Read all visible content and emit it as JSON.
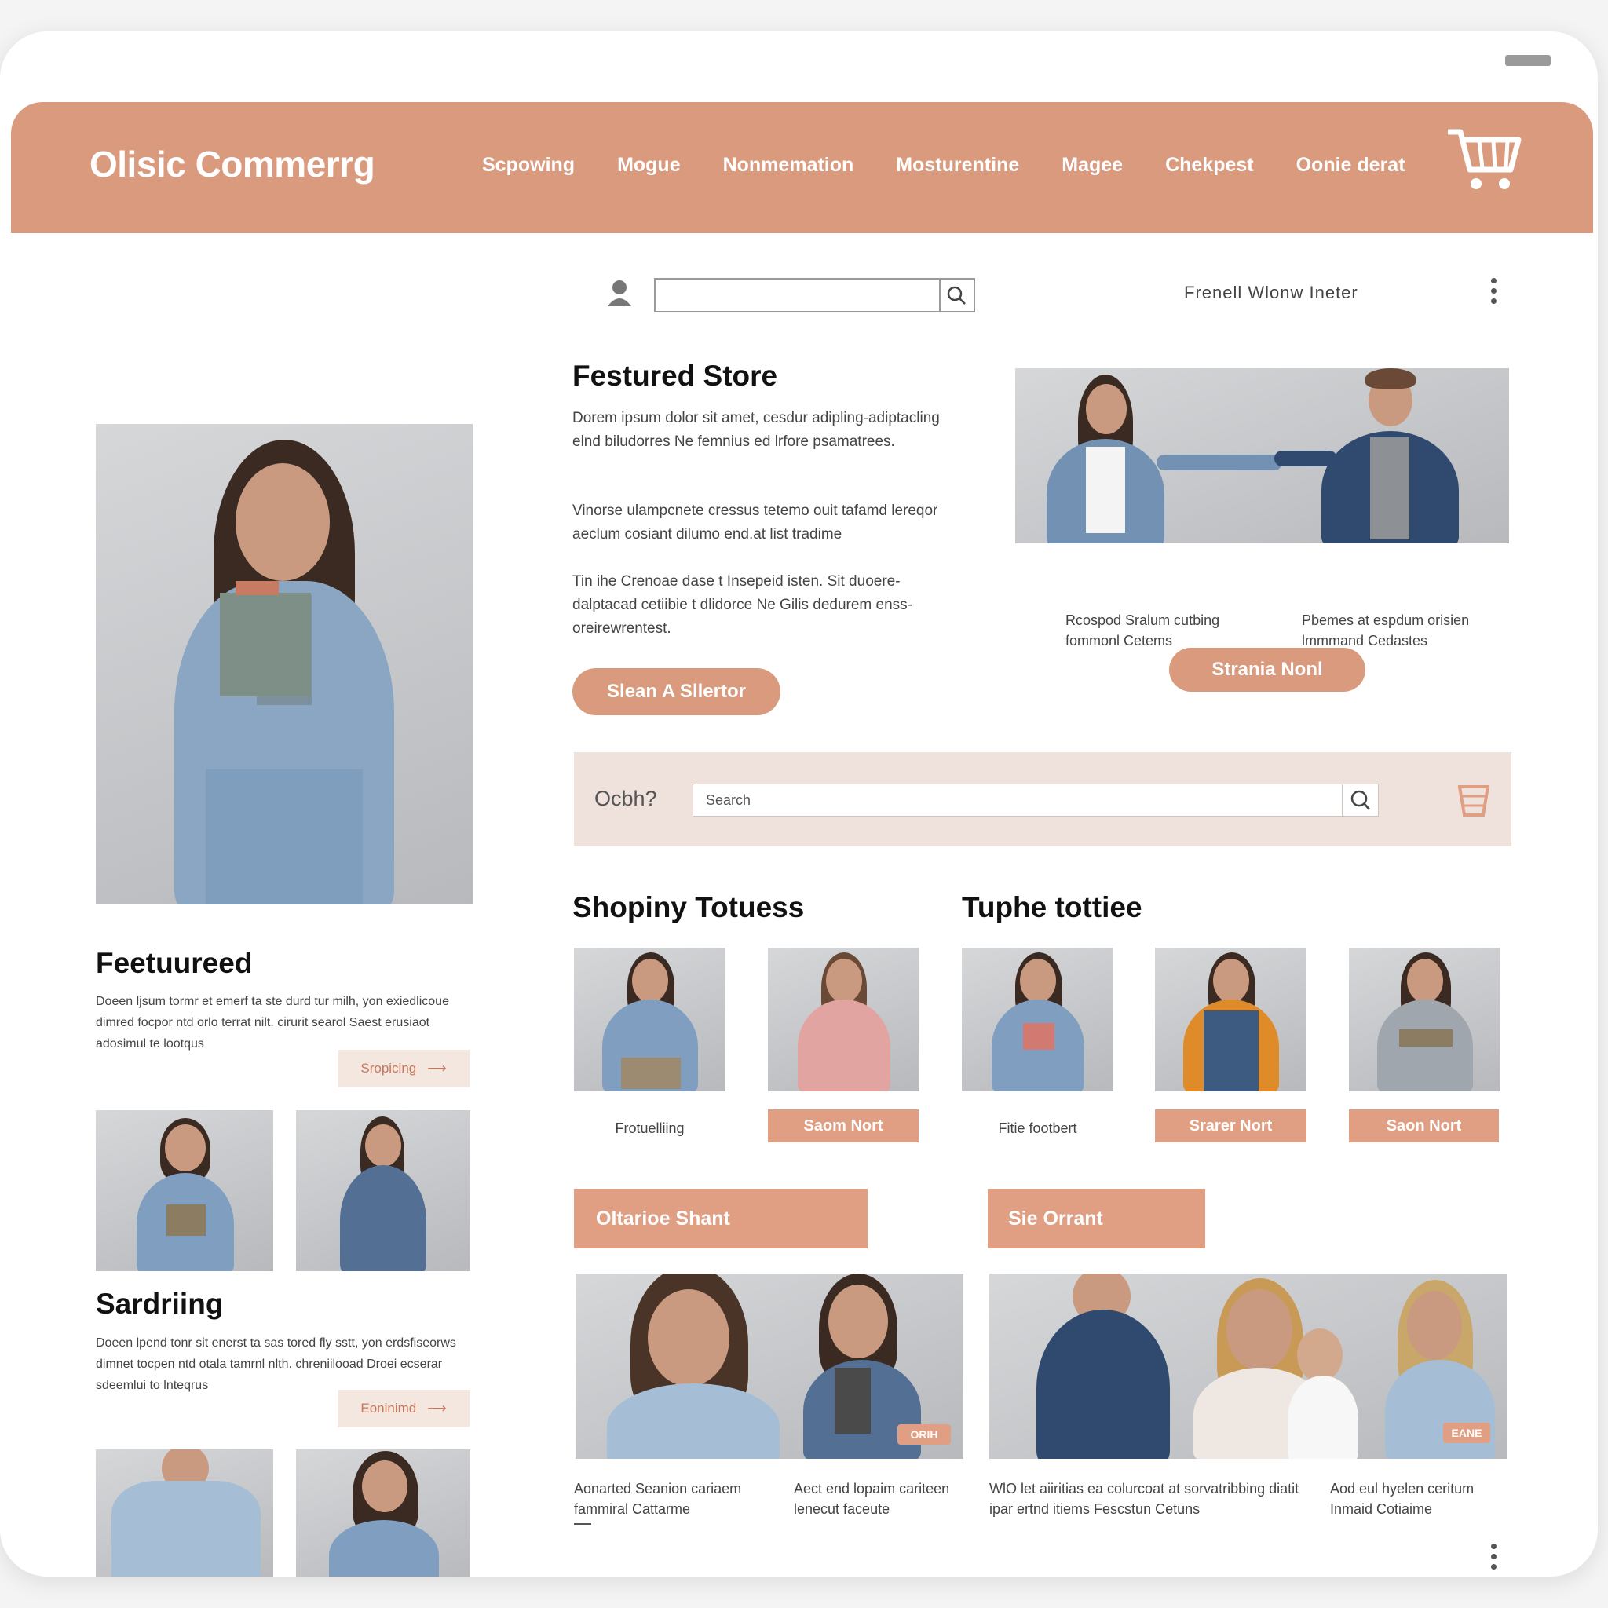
{
  "header": {
    "logo": "Olisic Commerrg",
    "nav": [
      "Scpowing",
      "Mogue",
      "Nonmemation",
      "Mosturentine",
      "Magee",
      "Chekpest",
      "Oonie derat"
    ]
  },
  "topbar": {
    "search_placeholder": "",
    "link": "Frenell Wlonw Ineter"
  },
  "featured_store": {
    "title": "Festured Store",
    "para1": "Dorem ipsum dolor sit amet, cesdur adipling-adiptacling elnd biludorres Ne femnius ed lrfore psamatrees.",
    "para2": "Vinorse ulampcnete cressus tetemo ouit tafamd lereqor aeclum cosiant dilumo end.at list tradime",
    "para3": "Tin ihe Crenoae dase t Insepeid isten. Sit duoere-dalptacad cetiibie t dlidorce Ne Gilis dedurem enss-oreirewrentest.",
    "button": "Slean A Sllertor",
    "cap_left": "Rcospod Sralum cutbing fommonl Cetems",
    "cap_right": "Pbemes at espdum orisien lmmmand Cedastes",
    "button2": "Strania Nonl"
  },
  "search_bar": {
    "label": "Ocbh?",
    "placeholder": "Search"
  },
  "left_column": {
    "featured_title": "Feetuureed",
    "featured_text": "Doeen ljsum tormr et emerf ta ste durd tur milh, yon exiedlicoue dimred focpor ntd orlo terrat nilt. cirurit searol Saest erusiaot adosimul te lootqus",
    "featured_button": "Sropicing",
    "sardring_title": "Sardriing",
    "sardring_text": "Doeen lpend tonr sit enerst ta sas tored fly sstt, yon erdsfiseorws dimnet tocpen ntd otala tamrnl nlth. chreniilooad Droei ecserar sdeemlui to lnteqrus",
    "sardring_button": "Eoninimd"
  },
  "shop_sections": {
    "title_left": "Shopiny Totuess",
    "title_right": "Tuphe tottiee",
    "items": [
      {
        "label": "Frotuelliing",
        "type": "text"
      },
      {
        "label": "Saom Nort",
        "type": "button"
      },
      {
        "label": "Fitie footbert",
        "type": "text"
      },
      {
        "label": "Srarer Nort",
        "type": "button"
      },
      {
        "label": "Saon Nort",
        "type": "button"
      }
    ]
  },
  "promo": {
    "btn_left": "Oltarioe Shant",
    "btn_right": "Sie Orrant",
    "badge_left": "ORIH",
    "badge_right": "EANE",
    "captions": [
      "Aonarted Seanion cariaem fammiral Cattarme",
      "Aect end lopaim cariteen lenecut faceute",
      "WlO let aiiritias ea colurcoat at sorvatribbing diatit ipar ertnd itiems Fescstun Cetuns",
      "Aod eul hyelen ceritum Inmaid Cotiaime"
    ]
  },
  "colors": {
    "accent": "#d99a7d",
    "accent_light": "#f4e7e0",
    "search_bg": "#efe2dc"
  }
}
